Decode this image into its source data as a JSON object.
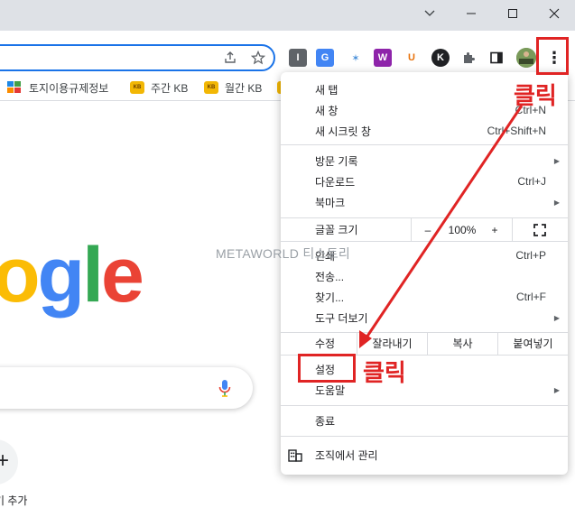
{
  "window": {
    "minimize": "—",
    "maximize": "☐",
    "close": "✕",
    "dropdown": "⌄"
  },
  "toolbar": {
    "share_icon": "share-icon",
    "star_icon": "star-icon",
    "extensions": [
      {
        "name": "extension-i-icon",
        "glyph": "I",
        "bg": "#5f6368",
        "fg": "#ffffff"
      },
      {
        "name": "translate-icon",
        "glyph": "G",
        "bg": "#4285f4",
        "fg": "#ffffff"
      },
      {
        "name": "eyedropper-icon",
        "glyph": "✶",
        "bg": "#ffffff",
        "fg": "#4a90d9"
      },
      {
        "name": "extension-w-icon",
        "glyph": "W",
        "bg": "#8e24aa",
        "fg": "#ffffff"
      },
      {
        "name": "extension-u-icon",
        "glyph": "U",
        "bg": "#ffffff",
        "fg": "#e8710a"
      },
      {
        "name": "extension-k-icon",
        "glyph": "K",
        "bg": "#202124",
        "fg": "#ffffff"
      }
    ],
    "puzzle_icon": "puzzle-icon",
    "sidepanel_icon": "side-panel-icon",
    "menu_glyph": "⋮"
  },
  "bookmarks": [
    {
      "label": "토지이용규제정보",
      "icon": "map-icon"
    },
    {
      "label": "주간 KB",
      "icon": "kb-icon"
    },
    {
      "label": "월간 KB",
      "icon": "kb-icon"
    }
  ],
  "page": {
    "logo_letters": [
      {
        "ch": "o",
        "color": "#fbbc05"
      },
      {
        "ch": "g",
        "color": "#4285f4"
      },
      {
        "ch": "l",
        "color": "#34a853"
      },
      {
        "ch": "e",
        "color": "#ea4335"
      }
    ],
    "shortcut_plus": "+",
    "shortcut_label": "기 추가"
  },
  "menu": {
    "new_tab": {
      "label": "새 탭",
      "shortcut": ""
    },
    "new_window": {
      "label": "새 창",
      "shortcut": "Ctrl+N"
    },
    "incognito": {
      "label": "새 시크릿 창",
      "shortcut": "Ctrl+Shift+N"
    },
    "history": {
      "label": "방문 기록"
    },
    "downloads": {
      "label": "다운로드",
      "shortcut": "Ctrl+J"
    },
    "bookmarks": {
      "label": "북마크"
    },
    "zoom": {
      "label": "글꼴 크기",
      "minus": "–",
      "value": "100%",
      "plus": "+"
    },
    "print": {
      "label": "인쇄",
      "shortcut": "Ctrl+P"
    },
    "cast": {
      "label": "전송..."
    },
    "find": {
      "label": "찾기...",
      "shortcut": "Ctrl+F"
    },
    "more_tools": {
      "label": "도구 더보기"
    },
    "edit": {
      "label": "수정",
      "cut": "잘라내기",
      "copy": "복사",
      "paste": "붙여넣기"
    },
    "settings": {
      "label": "설정"
    },
    "help": {
      "label": "도움말"
    },
    "exit": {
      "label": "종료"
    },
    "managed": {
      "label": "조직에서 관리"
    }
  },
  "watermark": "METAWORLD 티스토리",
  "annotations": {
    "click_top": "클릭",
    "click_settings": "클릭",
    "color": "#e02424"
  }
}
